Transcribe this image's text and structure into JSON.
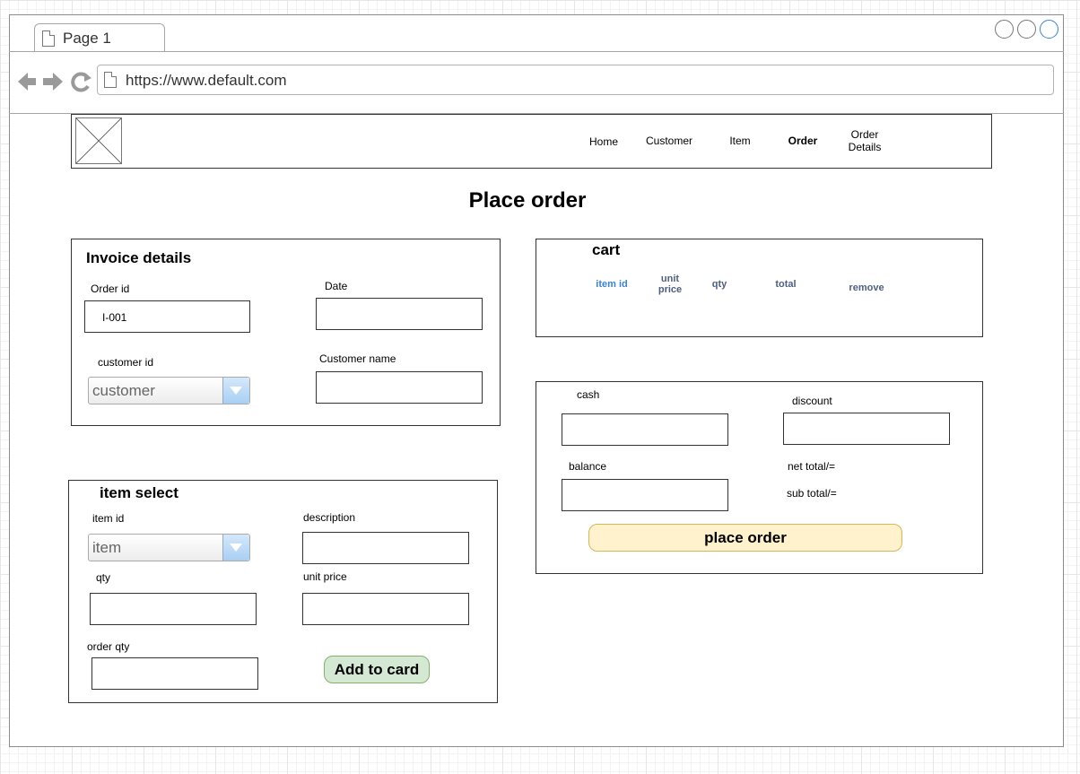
{
  "browser": {
    "tab_title": "Page 1",
    "url": "https://www.default.com"
  },
  "nav": {
    "items": [
      "Home",
      "Customer",
      "Item",
      "Order",
      "Order Details"
    ],
    "active": "Order"
  },
  "page_title": "Place order",
  "invoice": {
    "title": "Invoice details",
    "order_id_label": "Order id",
    "order_id_value": "I-001",
    "date_label": "Date",
    "customer_id_label": "customer id",
    "customer_select_value": "customer",
    "customer_name_label": "Customer name"
  },
  "item_select": {
    "title": "item select",
    "item_id_label": "item id",
    "item_select_value": "item",
    "description_label": "description",
    "qty_label": "qty",
    "unit_price_label": "unit price",
    "order_qty_label": "order qty",
    "add_button": "Add to card"
  },
  "cart": {
    "title": "cart",
    "columns": [
      "item id",
      "unit price",
      "qty",
      "total",
      "remove"
    ]
  },
  "payment": {
    "cash_label": "cash",
    "discount_label": "discount",
    "balance_label": "balance",
    "net_total_label": "net total/=",
    "sub_total_label": "sub total/=",
    "place_order_button": "place order"
  },
  "colors": {
    "accent_link": "#3b82d6",
    "cart_header": "#4d5f80",
    "add_button_fill": "#d5e8d4",
    "place_order_fill": "#fff2cc"
  }
}
